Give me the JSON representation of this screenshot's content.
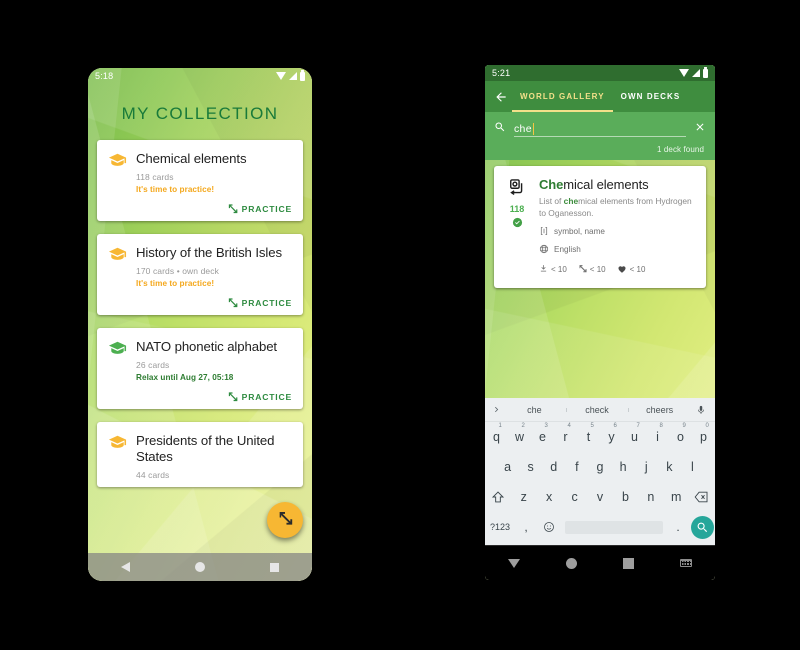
{
  "left_phone": {
    "status_bar": {
      "time": "5:18",
      "icons": [
        "wifi-icon",
        "signal-icon",
        "battery-icon"
      ]
    },
    "title": "MY COLLECTION",
    "decks": [
      {
        "name": "Chemical elements",
        "count": "118 cards",
        "status": "It's time to practice!",
        "status_kind": "practice",
        "icon": "graduation-cap-icon",
        "icon_color": "#f7b733",
        "action": "PRACTICE"
      },
      {
        "name": "History of the British Isles",
        "count": "170 cards • own deck",
        "status": "It's time to practice!",
        "status_kind": "practice",
        "icon": "graduation-cap-icon",
        "icon_color": "#f7b733",
        "action": "PRACTICE"
      },
      {
        "name": "NATO phonetic alphabet",
        "count": "26 cards",
        "status": "Relax until Aug 27, 05:18",
        "status_kind": "relax",
        "icon": "graduation-cap-icon",
        "icon_color": "#4caf50",
        "action": "PRACTICE"
      },
      {
        "name": "Presidents of the United States",
        "count": "44 cards",
        "status": "",
        "status_kind": "practice",
        "icon": "graduation-cap-icon",
        "icon_color": "#f7b733",
        "action": ""
      }
    ],
    "fab": {
      "icon": "practice-arrows-icon",
      "color": "#f7b733"
    },
    "nav_bar": [
      "back-icon",
      "home-icon",
      "recents-icon"
    ]
  },
  "right_phone": {
    "status_bar": {
      "time": "5:21",
      "icons": [
        "wifi-icon",
        "signal-icon",
        "battery-icon"
      ]
    },
    "app_bar": {
      "back_icon": "back-arrow-icon",
      "tabs": [
        {
          "label": "WORLD GALLERY",
          "active": true
        },
        {
          "label": "OWN DECKS",
          "active": false
        }
      ],
      "accent_color": "#f3e08a",
      "bar_color": "#3f8d3f"
    },
    "search": {
      "icon": "search-icon",
      "value": "che",
      "clear_icon": "close-icon",
      "result_count": "1 deck found"
    },
    "result": {
      "icon": "cards-stack-icon",
      "count": "118",
      "check_icon": "check-circle-icon",
      "title_highlight": "Che",
      "title_rest": "mical elements",
      "desc_pre": "List of ",
      "desc_highlight": "che",
      "desc_post": "mical elements from Hydrogen to Oganesson.",
      "fields_icon": "brackets-icon",
      "fields": "symbol, name",
      "language_icon": "globe-icon",
      "language": "English",
      "stats": [
        {
          "icon": "download-icon",
          "value": "< 10"
        },
        {
          "icon": "practice-arrows-icon",
          "value": "< 10"
        },
        {
          "icon": "heart-icon",
          "value": "< 10"
        }
      ]
    },
    "keyboard": {
      "suggestions": [
        "che",
        "check",
        "cheers"
      ],
      "expand_icon": "chevron-right-icon",
      "mic_icon": "microphone-icon",
      "row1": [
        {
          "key": "q",
          "num": "1"
        },
        {
          "key": "w",
          "num": "2"
        },
        {
          "key": "e",
          "num": "3"
        },
        {
          "key": "r",
          "num": "4"
        },
        {
          "key": "t",
          "num": "5"
        },
        {
          "key": "y",
          "num": "6"
        },
        {
          "key": "u",
          "num": "7"
        },
        {
          "key": "i",
          "num": "8"
        },
        {
          "key": "o",
          "num": "9"
        },
        {
          "key": "p",
          "num": "0"
        }
      ],
      "row2": [
        "a",
        "s",
        "d",
        "f",
        "g",
        "h",
        "j",
        "k",
        "l"
      ],
      "row3": [
        "z",
        "x",
        "c",
        "v",
        "b",
        "n",
        "m"
      ],
      "shift_icon": "shift-icon",
      "backspace_icon": "backspace-icon",
      "symbols_key": "?123",
      "comma_key": ",",
      "emoji_icon": "emoji-icon",
      "period_key": ".",
      "search_key_icon": "search-icon",
      "search_key_color": "#26a69a"
    },
    "nav_bar": [
      "dismiss-keyboard-icon",
      "home-icon",
      "recents-icon",
      "keyboard-indicator-icon"
    ]
  }
}
